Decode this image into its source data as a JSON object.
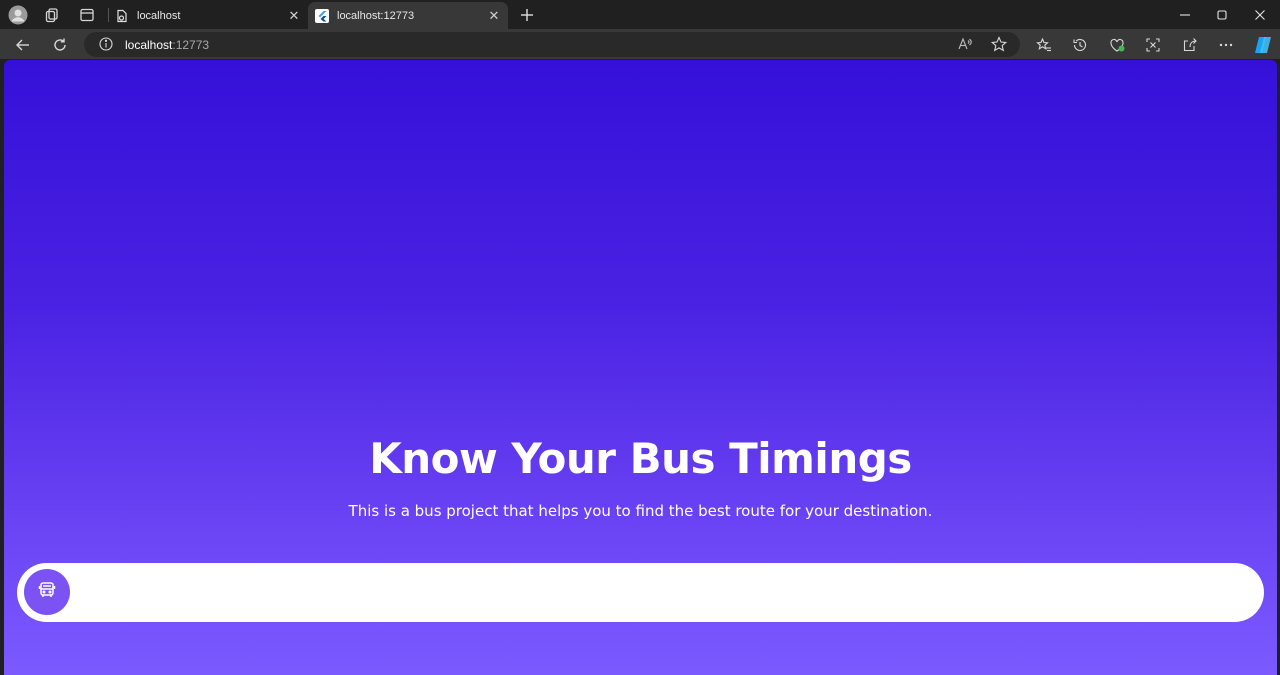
{
  "browser": {
    "tabs": [
      {
        "title": "localhost",
        "active": false
      },
      {
        "title": "localhost:12773",
        "active": true
      }
    ],
    "tab_close_glyph": "✕",
    "new_tab_glyph": "+",
    "address": {
      "host": "localhost",
      "port": ":12773"
    },
    "window_controls": {
      "minimize": "—",
      "maximize": "▢",
      "close": "✕"
    },
    "toolbar_icons": [
      "back-icon",
      "refresh-icon",
      "read-aloud-icon",
      "favorite-star-icon",
      "favorites-icon",
      "history-icon",
      "browser-essentials-icon",
      "screenshot-icon",
      "share-icon",
      "more-icon",
      "copilot-icon"
    ]
  },
  "page": {
    "title": "Know Your Bus Timings",
    "subtitle": "This is a bus project that helps you to find the best route for your destination.",
    "search": {
      "placeholder": "",
      "icon": "bus-icon"
    },
    "colors": {
      "gradient_top": "#3510d8",
      "gradient_bottom": "#7b5aff",
      "button": "#7b52f4"
    }
  }
}
